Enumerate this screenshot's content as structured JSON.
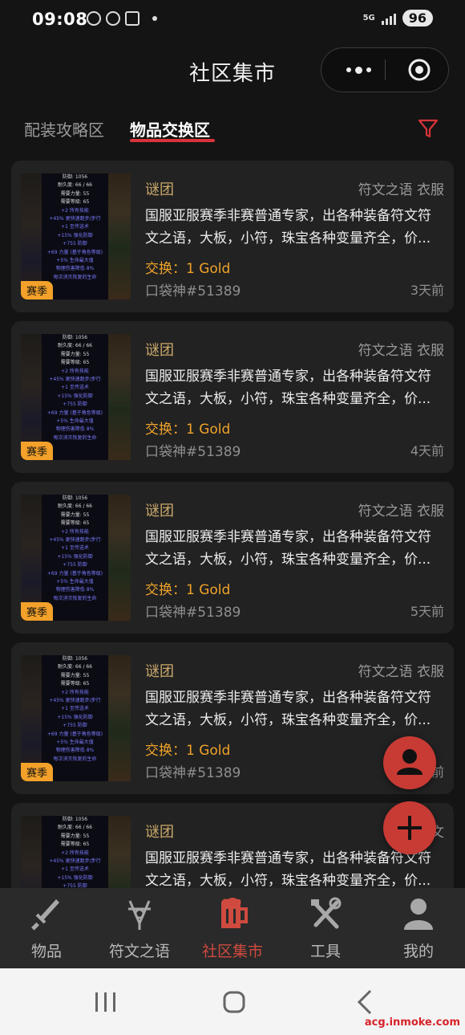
{
  "status_bar": {
    "time": "09:08",
    "network": "5G",
    "battery": "96"
  },
  "header": {
    "title": "社区集市"
  },
  "tabs": [
    {
      "label": "配装攻略区",
      "active": false
    },
    {
      "label": "物品交换区",
      "active": true
    }
  ],
  "thumbnail_text": [
    "防御: 1056",
    "耐久度: 66 / 66",
    "需要力量: 55",
    "需要等级: 65",
    "+2 所有技能",
    "+45% 更快速跑步/步行",
    "+1 至传送术",
    "+15% 强化防御",
    "+755 防御",
    "+69 力量 (基于角色等级)",
    "+5% 生命最大值",
    "物理伤害降低 8%",
    "每次消灭恢复的生命"
  ],
  "listings": [
    {
      "title": "谜团",
      "category": "符文之语 衣服",
      "desc_line1": "国服亚服赛季非赛普通专家，出各种装备符文符",
      "desc_line2": "文之语，大板，小符，珠宝各种变量齐全，价...",
      "trade": "交换：1 Gold",
      "user": "口袋神#51389",
      "time": "3天前",
      "badge": "赛季"
    },
    {
      "title": "谜团",
      "category": "符文之语 衣服",
      "desc_line1": "国服亚服赛季非赛普通专家，出各种装备符文符",
      "desc_line2": "文之语，大板，小符，珠宝各种变量齐全，价...",
      "trade": "交换：1 Gold",
      "user": "口袋神#51389",
      "time": "4天前",
      "badge": "赛季"
    },
    {
      "title": "谜团",
      "category": "符文之语 衣服",
      "desc_line1": "国服亚服赛季非赛普通专家，出各种装备符文符",
      "desc_line2": "文之语，大板，小符，珠宝各种变量齐全，价...",
      "trade": "交换：1 Gold",
      "user": "口袋神#51389",
      "time": "5天前",
      "badge": "赛季"
    },
    {
      "title": "谜团",
      "category": "符文之语 衣服",
      "desc_line1": "国服亚服赛季非赛普通专家，出各种装备符文符",
      "desc_line2": "文之语，大板，小符，珠宝各种变量齐全，价...",
      "trade": "交换：1 Gold",
      "user": "口袋神#51389",
      "time": "前",
      "badge": "赛季"
    },
    {
      "title": "谜团",
      "category": "符文",
      "desc_line1": "国服亚服赛季非赛普通专家，出各种装备符文符",
      "desc_line2": "文之语，大板，小符，珠宝各种变量齐全，价...",
      "trade": "",
      "user": "",
      "time": "",
      "badge": ""
    }
  ],
  "bottom_nav": [
    {
      "label": "物品",
      "icon": "sword-icon",
      "active": false
    },
    {
      "label": "符文之语",
      "icon": "rune-icon",
      "active": false
    },
    {
      "label": "社区集市",
      "icon": "beer-mug-icon",
      "active": true
    },
    {
      "label": "工具",
      "icon": "tools-icon",
      "active": false
    },
    {
      "label": "我的",
      "icon": "person-icon",
      "active": false
    }
  ],
  "watermark": "acg.inmoke.com",
  "colors": {
    "accent": "#d8333a",
    "gold": "#f0a32a",
    "badge": "#f3a12a",
    "fab": "#c83a34",
    "card_bg": "#222222"
  }
}
